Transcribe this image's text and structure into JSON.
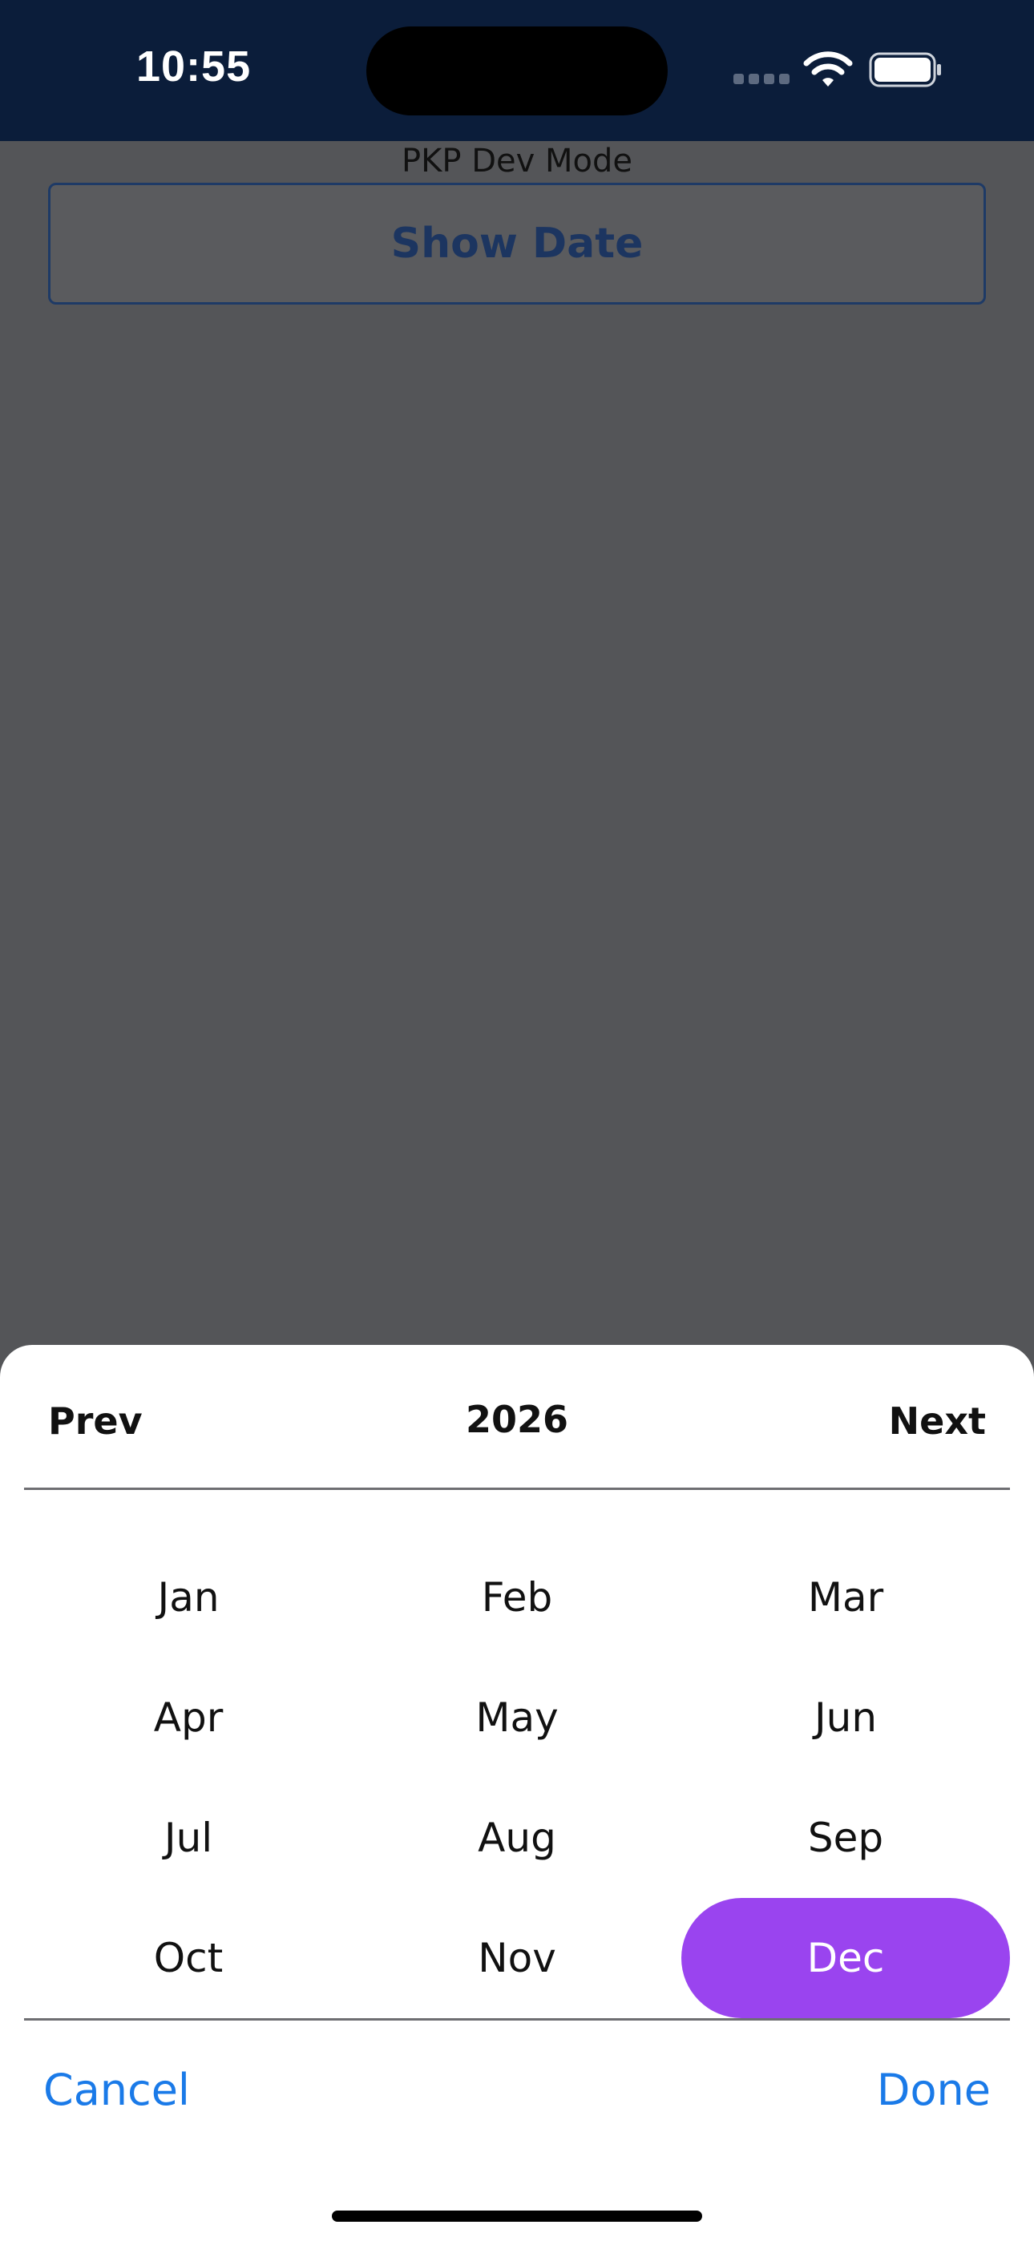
{
  "status_bar": {
    "time": "10:55",
    "icons": [
      "cellular-signal-icon",
      "wifi-icon",
      "battery-icon"
    ]
  },
  "page": {
    "dev_mode_label": "PKP Dev Mode",
    "show_date_label": "Show Date"
  },
  "picker": {
    "prev_label": "Prev",
    "year": "2026",
    "next_label": "Next",
    "months": [
      "Jan",
      "Feb",
      "Mar",
      "Apr",
      "May",
      "Jun",
      "Jul",
      "Aug",
      "Sep",
      "Oct",
      "Nov",
      "Dec"
    ],
    "selected_month": "Dec",
    "cancel_label": "Cancel",
    "done_label": "Done"
  },
  "colors": {
    "status_bar_bg": "#0b1d3a",
    "overlay": "#545558",
    "selected_month_bg": "#9a44ef",
    "action_link": "#1a7ae8",
    "button_text": "#1c3560"
  }
}
